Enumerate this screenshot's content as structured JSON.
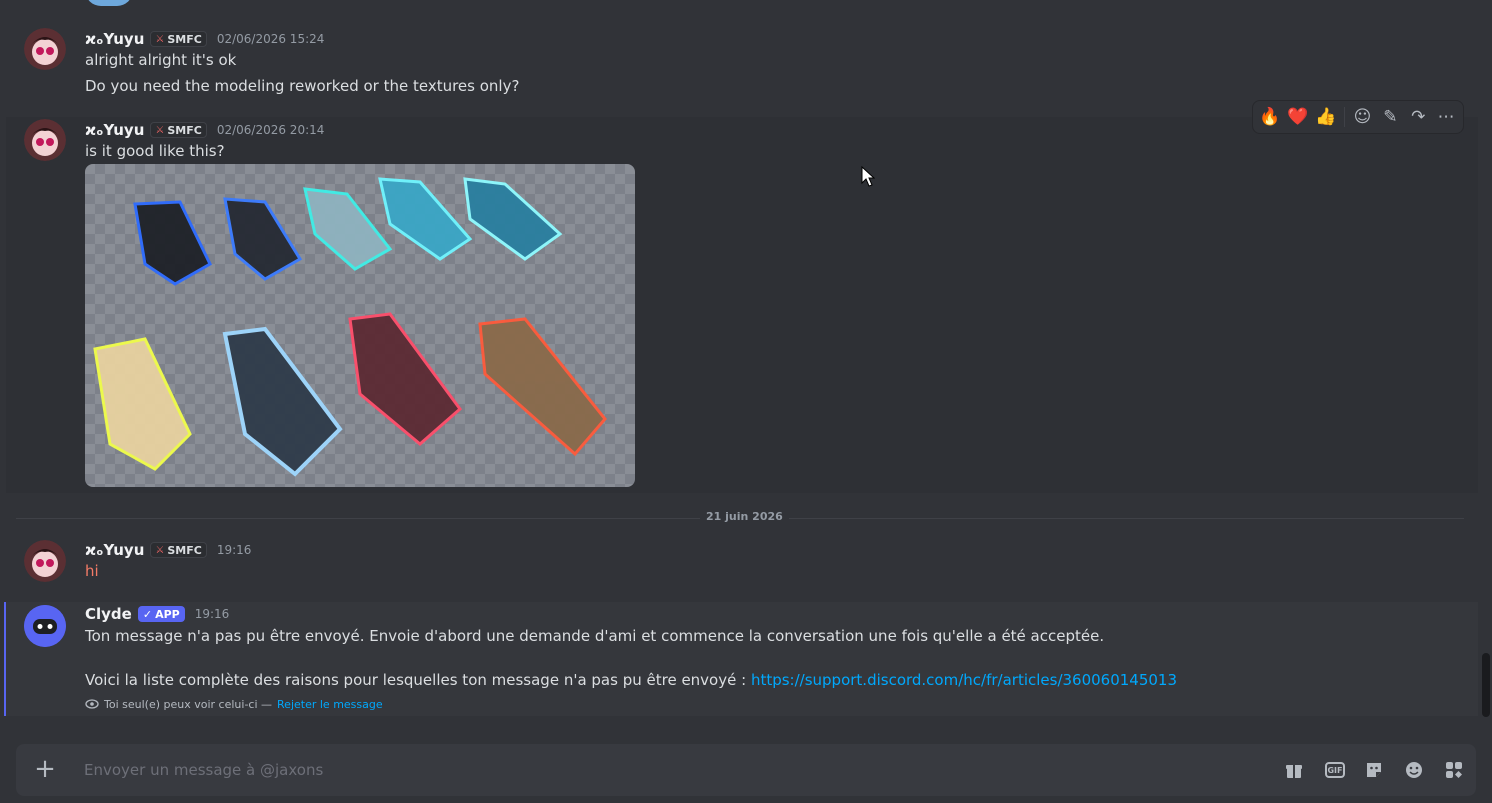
{
  "messages": [
    {
      "author": "ϰₒYuyu",
      "tag": "SMFC",
      "timestamp": "02/06/2026 15:24",
      "lines": [
        "alright alright  it's ok",
        "Do you need the modeling reworked or the textures only?"
      ]
    },
    {
      "author": "ϰₒYuyu",
      "tag": "SMFC",
      "timestamp": "02/06/2026 20:14",
      "lines": [
        "is it good like this?"
      ]
    },
    {
      "author": "ϰₒYuyu",
      "tag": "SMFC",
      "timestamp": "19:16",
      "lines": [
        "hi"
      ]
    }
  ],
  "date_divider": "21 juin 2026",
  "toolbar": {
    "reactions": [
      "🔥",
      "❤️",
      "👍"
    ],
    "icons": [
      "add-reaction-icon",
      "edit-icon",
      "forward-icon",
      "more-icon"
    ]
  },
  "clyde": {
    "author": "Clyde",
    "badge": "APP",
    "timestamp": "19:16",
    "line1": "Ton message n'a pas pu être envoyé. Envoie d'abord une demande d'ami et commence la conversation une fois qu'elle a été acceptée.",
    "line2_prefix": "Voici la liste complète des raisons pour lesquelles ton message n'a pas pu être envoyé : ",
    "link": "https://support.discord.com/hc/fr/articles/360060145013",
    "ephemeral_note": "Toi seul(e) peux voir celui-ci — ",
    "dismiss": "Rejeter le message"
  },
  "composer": {
    "placeholder": "Envoyer un message à @jaxons",
    "icons": [
      "gift-icon",
      "gif-icon",
      "sticker-icon",
      "emoji-icon",
      "apps-icon"
    ],
    "gif_label": "GIF"
  },
  "colors": {
    "background": "#313338",
    "accent": "#5865f2",
    "link": "#00a8fc",
    "mention_text": "#f47b67"
  }
}
